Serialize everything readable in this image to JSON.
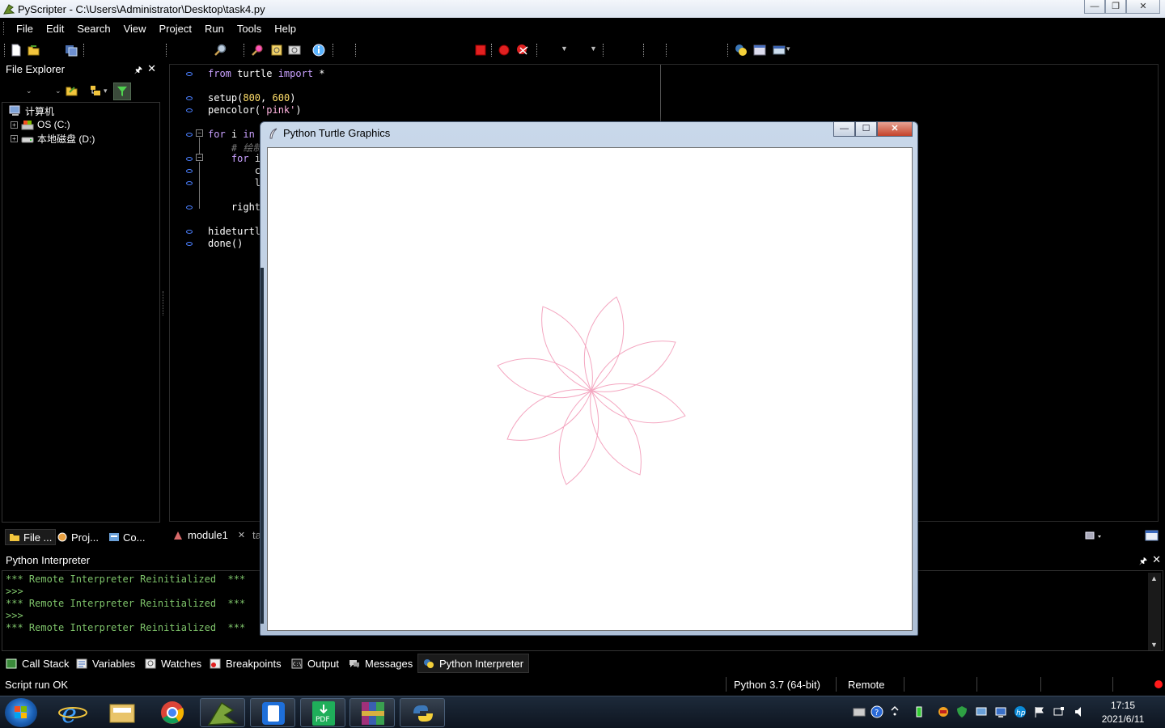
{
  "window": {
    "title": "PyScripter - C:\\Users\\Administrator\\Desktop\\task4.py",
    "minimize": "—",
    "maximize": "❐",
    "close": "✕"
  },
  "menu": [
    "File",
    "Edit",
    "Search",
    "View",
    "Project",
    "Run",
    "Tools",
    "Help"
  ],
  "file_explorer": {
    "title": "File Explorer",
    "pin": "🖈",
    "close": "✕",
    "tree": [
      {
        "label": "计算机",
        "icon": "computer-icon"
      },
      {
        "label": "OS (C:)",
        "icon": "drive-c-icon"
      },
      {
        "label": "本地磁盘 (D:)",
        "icon": "drive-d-icon"
      }
    ],
    "tabs": [
      "File ...",
      "Proj...",
      "Co..."
    ]
  },
  "editor": {
    "lines": [
      {
        "parts": [
          [
            "kw",
            "from"
          ],
          [
            "t",
            " turtle "
          ],
          [
            "kw",
            "import"
          ],
          [
            "t",
            " *"
          ]
        ]
      },
      {
        "parts": []
      },
      {
        "parts": [
          [
            "t",
            "setup("
          ],
          [
            "num",
            "800"
          ],
          [
            "t",
            ", "
          ],
          [
            "num",
            "600"
          ],
          [
            "t",
            ")"
          ]
        ]
      },
      {
        "parts": [
          [
            "t",
            "pencolor("
          ],
          [
            "str",
            "'pink'"
          ],
          [
            "t",
            ")"
          ]
        ]
      },
      {
        "parts": []
      },
      {
        "parts": [
          [
            "kw",
            "for"
          ],
          [
            "t",
            " i "
          ],
          [
            "kw",
            "in"
          ]
        ]
      },
      {
        "parts": [
          [
            "t",
            "    "
          ],
          [
            "cmt",
            "# 绘制"
          ]
        ]
      },
      {
        "parts": [
          [
            "t",
            "    "
          ],
          [
            "kw",
            "for"
          ],
          [
            "t",
            " i"
          ]
        ]
      },
      {
        "parts": [
          [
            "t",
            "        c"
          ]
        ]
      },
      {
        "parts": [
          [
            "t",
            "        l"
          ]
        ]
      },
      {
        "parts": []
      },
      {
        "parts": [
          [
            "t",
            "    right"
          ]
        ]
      },
      {
        "parts": []
      },
      {
        "parts": [
          [
            "t",
            "hideturtl"
          ]
        ]
      },
      {
        "parts": [
          [
            "t",
            "done()"
          ]
        ]
      }
    ],
    "tabs": [
      "module1",
      "ta"
    ],
    "tab_close": "✕"
  },
  "interpreter": {
    "title": "Python Interpreter",
    "pin": "🖈",
    "close": "✕",
    "lines": [
      "*** Remote Interpreter Reinitialized  ***",
      ">>>",
      "*** Remote Interpreter Reinitialized  ***",
      ">>>",
      "*** Remote Interpreter Reinitialized  ***"
    ]
  },
  "bottom_tabs": [
    "Call Stack",
    "Variables",
    "Watches",
    "Breakpoints",
    "Output",
    "Messages",
    "Python Interpreter"
  ],
  "status": {
    "message": "Script run OK",
    "python_version": "Python 3.7 (64-bit)",
    "engine": "Remote"
  },
  "turtle_window": {
    "title": "Python Turtle Graphics",
    "minimize": "—",
    "maximize": "☐",
    "close": "✕",
    "pen_color": "#f4a6c0",
    "petals": 8
  },
  "taskbar": {
    "apps": [
      "windows-start-icon",
      "internet-explorer-icon",
      "file-explorer-icon",
      "chrome-icon",
      "pyscripter-icon",
      "phone-icon",
      "pdf-icon",
      "winrar-icon",
      "python-icon"
    ],
    "pdf_label": "PDF",
    "clock_time": "17:15",
    "clock_date": "2021/6/11"
  }
}
